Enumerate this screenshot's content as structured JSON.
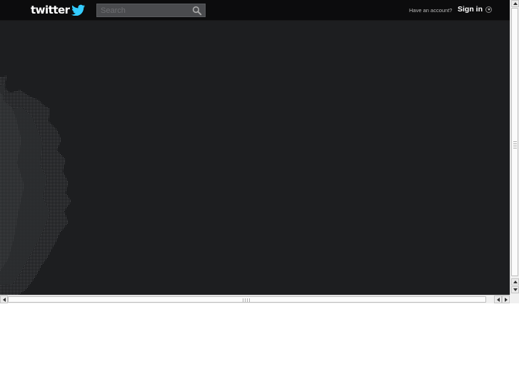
{
  "header": {
    "logo_text": "twitter",
    "search": {
      "placeholder": "Search",
      "value": ""
    },
    "account_prompt": "Have an account?",
    "signin_label": "Sign in"
  },
  "colors": {
    "page_background": "#1d1e20",
    "topbar_background": "#0c0c0d",
    "search_background": "#4a4b4e",
    "brand_bird": "#33ccff"
  },
  "icons": {
    "logo": "twitter-bird-icon",
    "search": "magnifier-icon",
    "signin_menu": "chevron-down-circle-icon"
  }
}
